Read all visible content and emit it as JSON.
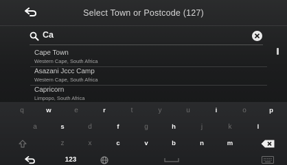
{
  "header": {
    "title": "Select Town or Postcode (127)"
  },
  "search": {
    "value": "Ca"
  },
  "results": [
    {
      "name": "Cape Town",
      "region": "Western Cape, South Africa"
    },
    {
      "name": "Asazani Jccc Camp",
      "region": "Western Cape, South Africa"
    },
    {
      "name": "Capricorn",
      "region": "Limpopo, South Africa"
    }
  ],
  "keyboard": {
    "row1": [
      "q",
      "w",
      "e",
      "r",
      "t",
      "y",
      "u",
      "i",
      "o",
      "p"
    ],
    "row2": [
      "a",
      "s",
      "d",
      "f",
      "g",
      "h",
      "j",
      "k",
      "l"
    ],
    "row3": [
      "z",
      "x",
      "c",
      "v",
      "b",
      "n",
      "m"
    ],
    "numbers_label": "123"
  },
  "colors": {
    "active_key": "#ffffff",
    "inactive_key": "#7a7a7a",
    "background": "#1c1d1e"
  }
}
